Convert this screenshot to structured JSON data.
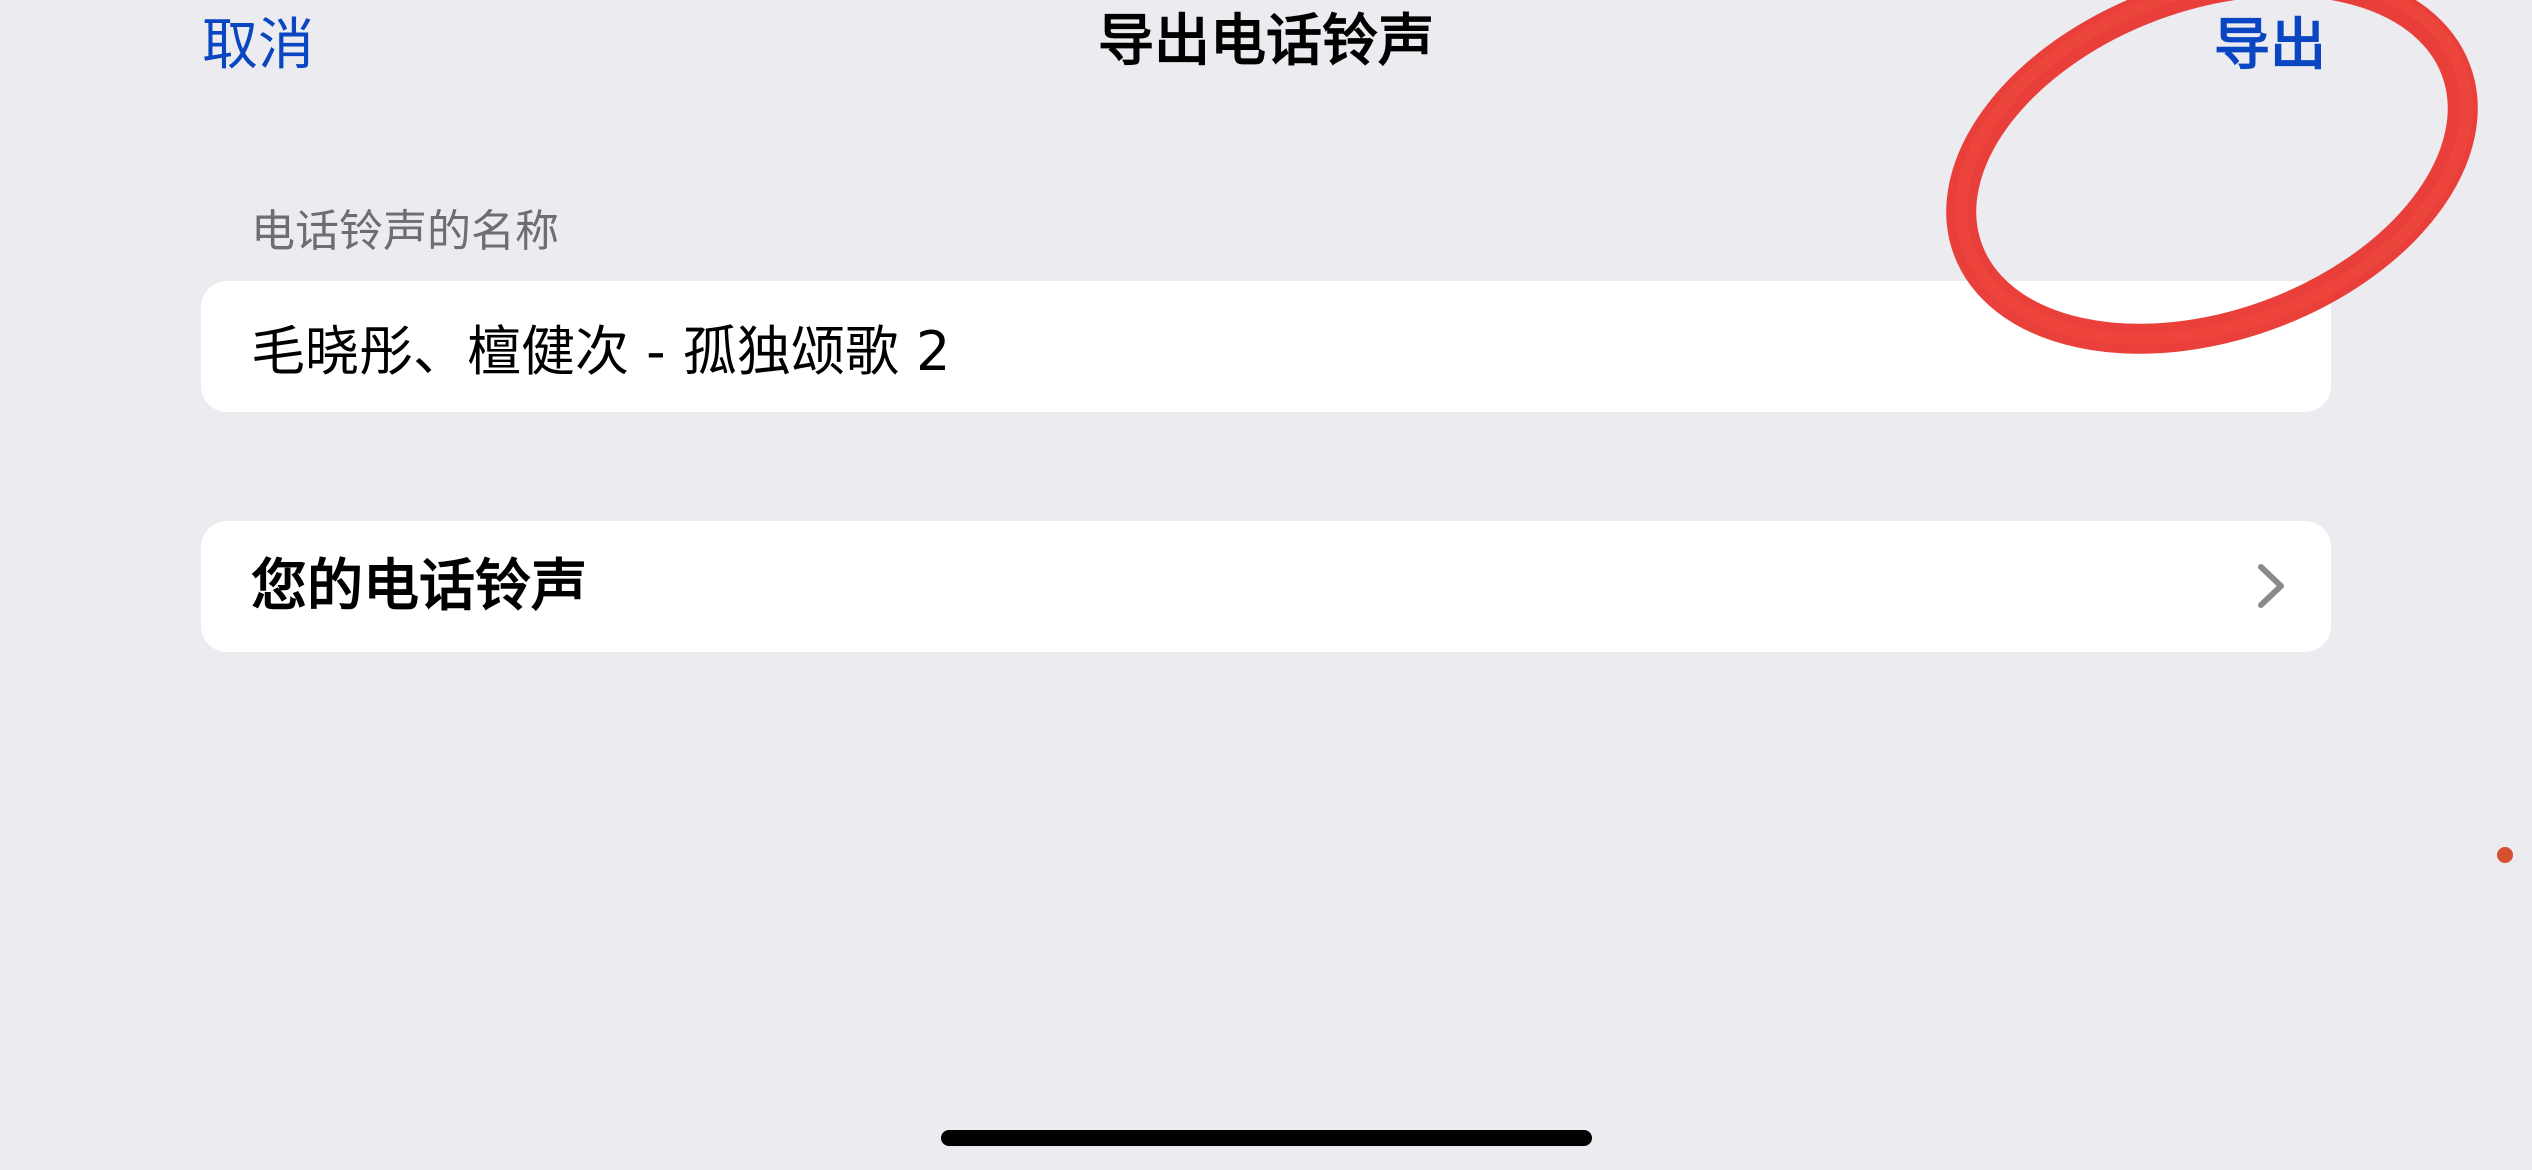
{
  "nav": {
    "cancel_label": "取消",
    "title": "导出电话铃声",
    "export_label": "导出"
  },
  "form": {
    "section_header": "电话铃声的名称",
    "name_value": "毛晓彤、檀健次 - 孤独颂歌 2"
  },
  "ringtones": {
    "label": "您的电话铃声",
    "icon": "chevron-right-icon"
  },
  "colors": {
    "accent": "#0a45c2",
    "background": "#ebebf0",
    "card": "#ffffff",
    "annotation": "#e8302a"
  }
}
